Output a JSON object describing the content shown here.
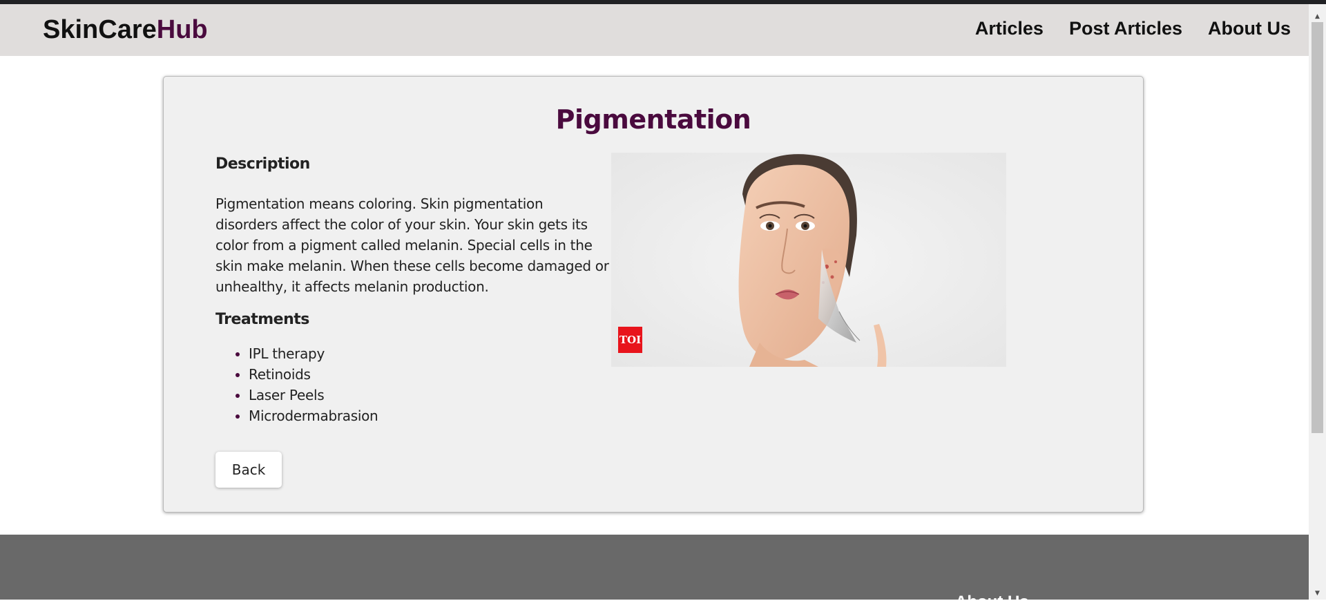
{
  "header": {
    "brand_part1": "SkinCare",
    "brand_part2": "Hub",
    "nav": [
      "Articles",
      "Post Articles",
      "About Us"
    ]
  },
  "article": {
    "title": "Pigmentation",
    "description_heading": "Description",
    "description": "Pigmentation means coloring. Skin pigmentation disorders affect the color of your skin. Your skin gets its color from a pigment called melanin. Special cells in the skin make melanin. When these cells become damaged or unhealthy, it affects melanin production.",
    "treatments_heading": "Treatments",
    "treatments": [
      "IPL therapy",
      "Retinoids",
      "Laser Peels",
      "Microdermabrasion"
    ],
    "back_label": "Back",
    "image_logo_text": "TOI"
  },
  "footer": {
    "heading": "About Us"
  },
  "colors": {
    "brand_accent": "#4a0a3e",
    "navbar_bg": "#e0dddc",
    "card_bg": "#f0f0f0",
    "footer_bg": "#696969",
    "logo_red": "#e8141c"
  }
}
